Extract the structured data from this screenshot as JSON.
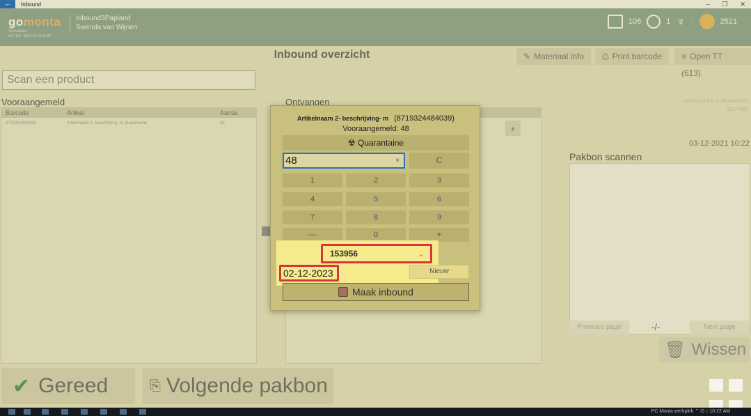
{
  "window": {
    "title": "Inbound",
    "back_glyph": "←",
    "controls": [
      "–",
      "❐",
      "✕"
    ]
  },
  "header": {
    "logo_prefix": "go",
    "logo_suffix": "monta",
    "logo_sub1": "Werkstation",
    "logo_sub2": "v2.7.8.6 · 2021.12.03.10:58",
    "user_line1": "Inbound3Papland",
    "user_line2": "Swenda van Wijnen",
    "stat_calendar": "106",
    "stat_clock": "1",
    "stat_trophy": "·",
    "stat_coins": "2521"
  },
  "page": {
    "title": "Inbound overzicht",
    "materiaal_info": "Materiaal info",
    "print_barcode": "Print barcode",
    "open_tt": "Open TT (613)",
    "scan_placeholder": "Scan een product"
  },
  "vooraangemeld": {
    "label": "Vooraangemeld",
    "columns": [
      "Barcode",
      "Artikel",
      "Aantal"
    ],
    "rows": [
      {
        "barcode": "8719324484039",
        "artikel": "Artikelnaam 2- beschrijving- m Quarantaine",
        "aantal": "48"
      }
    ]
  },
  "ontvangen": {
    "label": "Ontvangen"
  },
  "right": {
    "supplier_line1": "Leverancier B.V. (leverancier)",
    "supplier_line2": "65277863",
    "supplier_line3": "-",
    "date": "03-12-2021 10:22",
    "pakbon_label": "Pakbon scannen",
    "prev_page": "Previous page",
    "page_indicator": "-/-",
    "next_page": "Next page",
    "wissen": "Wissen"
  },
  "bottom": {
    "gereed": "Gereed",
    "volgende": "Volgende pakbon"
  },
  "taskbar": {
    "tray": "PC Monta werkplek  ⌃  ⊡  ♪  10:22 AM"
  },
  "dialog": {
    "article_name": "Artikelnaam 2- beschrijving- m",
    "article_code": "(8719324484039)",
    "announced": "Vooraangemeld: 48",
    "quarantine": "Quarantaine",
    "quantity": "48",
    "clear_glyph": "×",
    "keys": [
      "C",
      "1",
      "2",
      "3",
      "4",
      "5",
      "6",
      "7",
      "8",
      "9",
      "—",
      "0",
      "+"
    ],
    "lot_number": "153956",
    "expiry_date": "02-12-2023",
    "new_button": "Nieuw",
    "submit_button": "Maak inbound"
  },
  "colors": {
    "highlight": "#f5ea8c",
    "callout_border": "#d9353a",
    "header_bg": "#8e9f82"
  }
}
